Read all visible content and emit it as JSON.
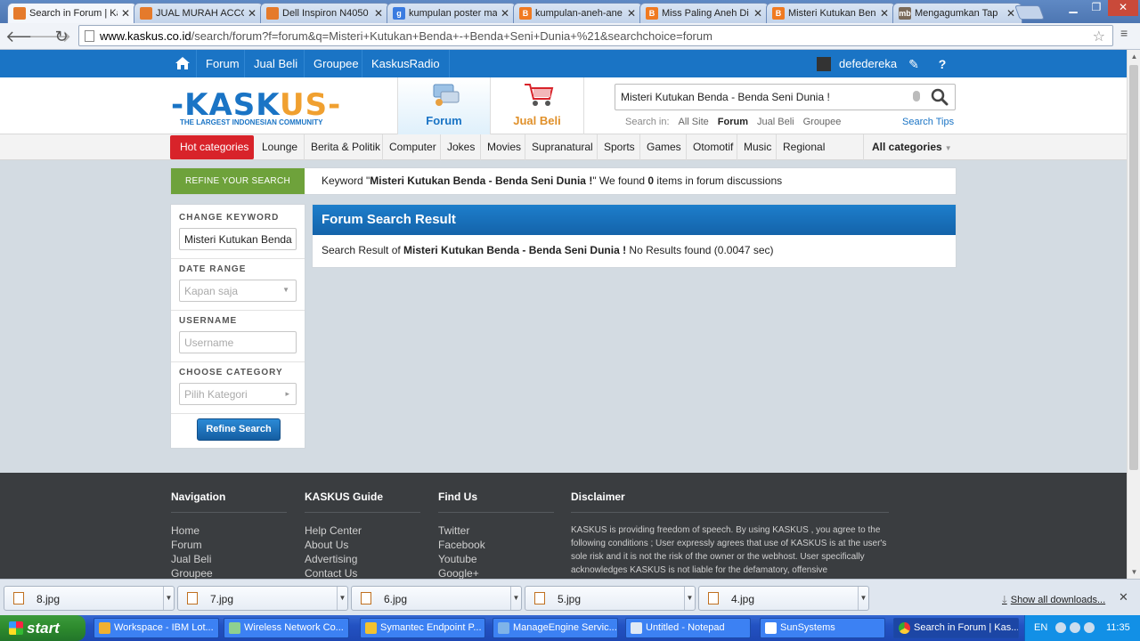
{
  "browser": {
    "tabs": [
      {
        "label": "Search in Forum | Kaskus",
        "favicon_color": "#e57a2b",
        "active": true
      },
      {
        "label": "JUAL MURAH ACCOR",
        "favicon_color": "#e57a2b",
        "active": false
      },
      {
        "label": "Dell Inspiron N4050",
        "favicon_color": "#e57a2b",
        "active": false
      },
      {
        "label": "kumpulan poster ma",
        "favicon_color": "#3a7be0",
        "active": false
      },
      {
        "label": "kumpulan-aneh-ane",
        "favicon_color": "#f07a21",
        "active": false
      },
      {
        "label": "Miss Paling Aneh Di",
        "favicon_color": "#f07a21",
        "active": false
      },
      {
        "label": "Misteri Kutukan Ben",
        "favicon_color": "#f07a21",
        "active": false
      },
      {
        "label": "Mengagumkan Tap",
        "favicon_color": "#7a6a5a",
        "active": false
      }
    ],
    "url_host": "www.kaskus.co.id",
    "url_path": "/search/forum?f=forum&q=Misteri+Kutukan+Benda+-+Benda+Seni+Dunia+%21&searchchoice=forum"
  },
  "kaskus_bar": {
    "links": [
      "Forum",
      "Jual Beli",
      "Groupee",
      "KaskusRadio"
    ],
    "username": "defedereka"
  },
  "header": {
    "logo_text_a": "KASK",
    "logo_text_b": "US",
    "logo_tagline": "THE LARGEST INDONESIAN COMMUNITY",
    "nav_forum": "Forum",
    "nav_jualbeli": "Jual Beli",
    "search_value": "Misteri Kutukan Benda - Benda Seni Dunia !",
    "search_in_label": "Search in:",
    "search_in_options": [
      "All Site",
      "Forum",
      "Jual Beli",
      "Groupee"
    ],
    "search_in_selected": "Forum",
    "search_tips": "Search Tips"
  },
  "categories": {
    "hot": "Hot categories",
    "items": [
      "Lounge",
      "Berita & Politik",
      "Computer",
      "Jokes",
      "Movies",
      "Supranatural",
      "Sports",
      "Games",
      "Otomotif",
      "Music",
      "Regional"
    ],
    "all": "All categories"
  },
  "refine_bar": {
    "tag": "REFINE YOUR SEARCH",
    "msg_prefix": "Keyword \"",
    "keyword": "Misteri Kutukan Benda - Benda Seni Dunia !",
    "msg_mid": "\" We found ",
    "count": "0",
    "msg_suffix": " items in forum discussions"
  },
  "sidebar": {
    "change_keyword_label": "CHANGE KEYWORD",
    "change_keyword_value": "Misteri Kutukan Benda",
    "date_range_label": "DATE RANGE",
    "date_range_value": "Kapan saja",
    "username_label": "USERNAME",
    "username_placeholder": "Username",
    "category_label": "CHOOSE CATEGORY",
    "category_value": "Pilih Kategori",
    "refine_button": "Refine Search"
  },
  "result": {
    "title": "Forum Search Result",
    "msg_prefix": "Search Result of ",
    "keyword": "Misteri Kutukan Benda - Benda Seni Dunia !",
    "msg_suffix": " No Results found (0.0047 sec)"
  },
  "footer": {
    "navigation": {
      "title": "Navigation",
      "links": [
        "Home",
        "Forum",
        "Jual Beli",
        "Groupee"
      ]
    },
    "guide": {
      "title": "KASKUS Guide",
      "links": [
        "Help Center",
        "About Us",
        "Advertising",
        "Contact Us"
      ]
    },
    "findus": {
      "title": "Find Us",
      "links": [
        "Twitter",
        "Facebook",
        "Youtube",
        "Google+"
      ]
    },
    "disclaimer": {
      "title": "Disclaimer",
      "text": "KASKUS is providing freedom of speech. By using KASKUS , you agree to the following conditions ; User expressly agrees that use of KASKUS is at the user's sole risk and it is not the risk of the owner or the webhost. User specifically acknowledges KASKUS is not liable for the defamatory, offensive"
    }
  },
  "downloads": {
    "files": [
      "8.jpg",
      "7.jpg",
      "6.jpg",
      "5.jpg",
      "4.jpg"
    ],
    "show_all": "Show all downloads..."
  },
  "taskbar": {
    "start": "start",
    "tasks": [
      {
        "label": "Workspace - IBM Lot...",
        "active": false
      },
      {
        "label": "Wireless Network Co...",
        "active": false
      },
      {
        "label": "Symantec Endpoint P...",
        "active": false
      },
      {
        "label": "ManageEngine Servic...",
        "active": false
      },
      {
        "label": "Untitled - Notepad",
        "active": false
      },
      {
        "label": "SunSystems",
        "active": false
      },
      {
        "label": "Search in Forum | Kas...",
        "active": true
      }
    ],
    "lang": "EN",
    "clock": "11:35"
  }
}
